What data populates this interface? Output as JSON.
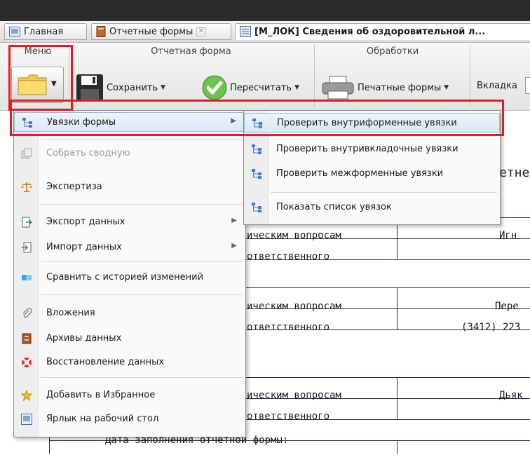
{
  "tabs": [
    {
      "label": "Главная"
    },
    {
      "label": "Отчетные формы",
      "close": "✕"
    },
    {
      "label": "[М_ЛОК] Сведения об оздоровительной л..."
    }
  ],
  "ribbon": {
    "groups": {
      "menu": "Меню",
      "report_form": "Отчетная форма",
      "processing": "Обработки"
    },
    "save_label": "Сохранить",
    "recalc_label": "Пересчитать",
    "print_forms_label": "Печатные формы",
    "vkladka_label": "Вкладка",
    "caret": "▼"
  },
  "document": {
    "header_fragment": "етне",
    "rows": [
      {
        "left": "ическим вопросам",
        "right": "Игн"
      },
      {
        "left": "ответственного",
        "right": ""
      },
      {
        "left": "ическим вопросам",
        "right": "Пере"
      },
      {
        "left": "ответственного",
        "right": "(3412) 223"
      },
      {
        "left": "ическим вопросам",
        "right": "Дьяк"
      },
      {
        "left": "ответственного",
        "right": ""
      }
    ],
    "footer_label": "Дата заполнения отчетной формы:"
  },
  "main_menu": {
    "items": [
      {
        "label": "Увязки формы",
        "icon": "links-icon",
        "submenu": true
      },
      {
        "label": "Собрать сводную",
        "icon": "collect-icon",
        "disabled": true
      },
      {
        "label": "Экспертиза",
        "icon": "scales-icon"
      },
      {
        "label": "Экспорт данных",
        "icon": "export-icon",
        "submenu": true
      },
      {
        "label": "Импорт данных",
        "icon": "import-icon",
        "submenu": true
      },
      {
        "label": "Сравнить с историей изменений",
        "icon": "compare-icon"
      },
      {
        "label": "Вложения",
        "icon": "paperclip-icon"
      },
      {
        "label": "Архивы данных",
        "icon": "archive-icon"
      },
      {
        "label": "Восстановление данных",
        "icon": "lifebuoy-icon"
      },
      {
        "label": "Добавить в Избранное",
        "icon": "star-icon"
      },
      {
        "label": "Ярлык на рабочий стол",
        "icon": "shortcut-icon"
      }
    ],
    "arrow": "▶"
  },
  "submenu": {
    "items": [
      {
        "label": "Проверить внутриформенные увязки"
      },
      {
        "label": "Проверить внутривкладочные увязки"
      },
      {
        "label": "Проверить межформенные увязки"
      },
      {
        "label": "Показать список увязок"
      }
    ]
  },
  "colors": {
    "highlight_red": "#e01d22",
    "doc_border": "#1d2a5a",
    "green_check": "#6cc24a"
  }
}
